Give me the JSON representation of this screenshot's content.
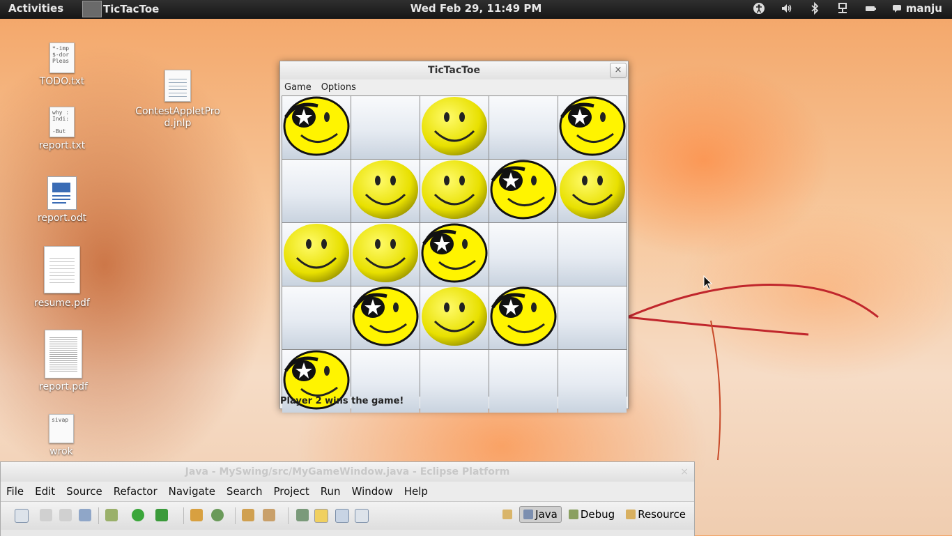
{
  "topbar": {
    "activities": "Activities",
    "app_name": "TicTacToe",
    "clock": "Wed Feb 29, 11:49 PM",
    "user": "manju",
    "tray_icons": [
      "accessibility-icon",
      "volume-icon",
      "bluetooth-icon",
      "network-icon",
      "battery-icon"
    ]
  },
  "desktop": {
    "icons": [
      {
        "label": "TODO.txt",
        "preview": "*-imp\n$-dor\nPleas"
      },
      {
        "label": "report.txt",
        "preview": "why :\nIndi:\n\n-But"
      },
      {
        "label": "report.odt",
        "preview": ""
      },
      {
        "label": "resume.pdf",
        "preview": ""
      },
      {
        "label": "report.pdf",
        "preview": ""
      },
      {
        "label": "wrok",
        "preview": "sivap"
      },
      {
        "label": "ContestAppletProd.jnlp",
        "preview": ""
      }
    ]
  },
  "tictactoe": {
    "title": "TicTacToe",
    "close": "×",
    "menu": [
      "Game",
      "Options"
    ],
    "board": [
      [
        "pirate",
        "",
        "smiley",
        "",
        "pirate"
      ],
      [
        "",
        "smiley",
        "smiley",
        "pirate",
        "smiley"
      ],
      [
        "smiley",
        "smiley",
        "pirate",
        "",
        ""
      ],
      [
        "",
        "pirate",
        "smiley",
        "pirate",
        ""
      ],
      [
        "pirate",
        "",
        "",
        "",
        ""
      ]
    ],
    "status": "Player 2 wins the game!"
  },
  "eclipse": {
    "title": "Java - MySwing/src/MyGameWindow.java - Eclipse Platform",
    "close": "×",
    "menu": [
      "File",
      "Edit",
      "Source",
      "Refactor",
      "Navigate",
      "Search",
      "Project",
      "Run",
      "Window",
      "Help"
    ],
    "perspectives": [
      {
        "label": "Java",
        "active": true
      },
      {
        "label": "Debug",
        "active": false
      },
      {
        "label": "Resource",
        "active": false
      }
    ]
  }
}
